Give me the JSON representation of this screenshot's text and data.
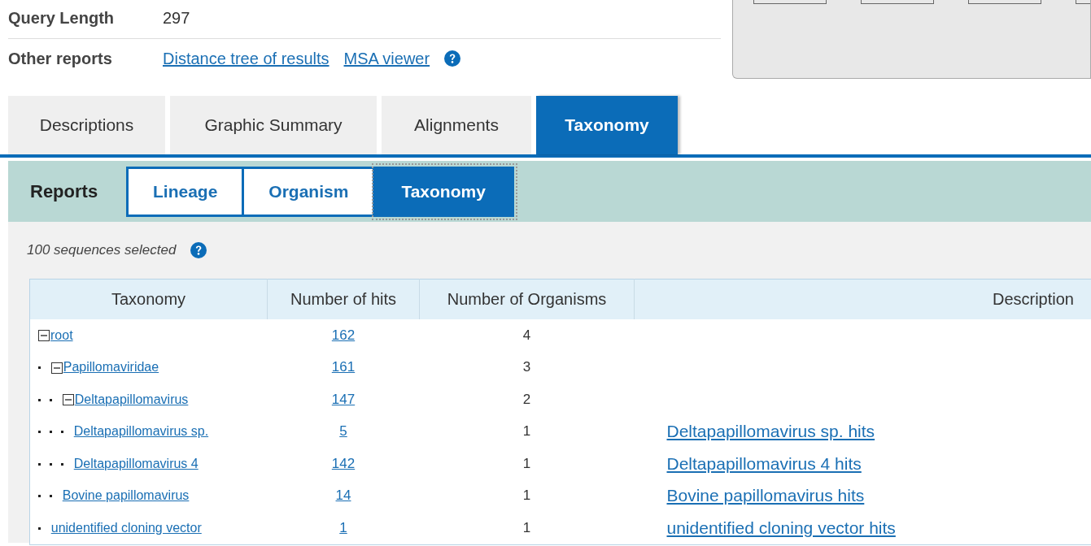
{
  "summary": {
    "rows": [
      {
        "label": "Query Length",
        "value": "297"
      },
      {
        "label": "Other reports",
        "links": [
          "Distance tree of results",
          "MSA viewer"
        ],
        "help": true
      }
    ]
  },
  "tabs": [
    {
      "label": "Descriptions",
      "selected": false
    },
    {
      "label": "Graphic Summary",
      "selected": false
    },
    {
      "label": "Alignments",
      "selected": false
    },
    {
      "label": "Taxonomy",
      "selected": true
    }
  ],
  "reports": {
    "label": "Reports",
    "buttons": [
      {
        "label": "Lineage",
        "selected": false
      },
      {
        "label": "Organism",
        "selected": false
      },
      {
        "label": "Taxonomy",
        "selected": true
      }
    ]
  },
  "selection_note": "100 sequences selected",
  "table": {
    "columns": [
      "Taxonomy",
      "Number of hits",
      "Number of Organisms",
      "Description"
    ],
    "rows": [
      {
        "name": "root",
        "hits": "162",
        "organisms": "4",
        "expanded": true,
        "children": [
          {
            "name": "Papillomaviridae",
            "hits": "161",
            "organisms": "3",
            "expanded": true,
            "children": [
              {
                "name": "Deltapapillomavirus",
                "hits": "147",
                "organisms": "2",
                "expanded": true,
                "children": [
                  {
                    "name": "Deltapapillomavirus sp.",
                    "hits": "5",
                    "organisms": "1",
                    "description": "Deltapapillomavirus sp. hits"
                  },
                  {
                    "name": "Deltapapillomavirus 4",
                    "hits": "142",
                    "organisms": "1",
                    "description": "Deltapapillomavirus 4 hits"
                  }
                ]
              },
              {
                "name": "Bovine papillomavirus",
                "hits": "14",
                "organisms": "1",
                "description": "Bovine papillomavirus hits"
              }
            ]
          },
          {
            "name": "unidentified cloning vector",
            "hits": "1",
            "organisms": "1",
            "description": "unidentified cloning vector hits"
          }
        ]
      }
    ]
  }
}
